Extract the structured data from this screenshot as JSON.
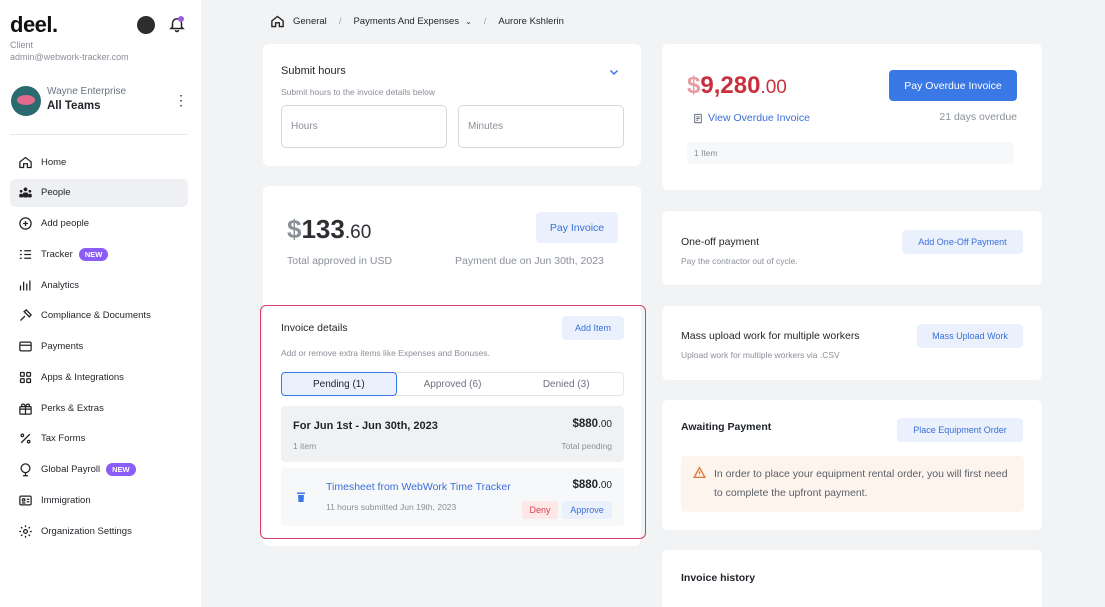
{
  "app": {
    "logo": "deel.",
    "role": "Client",
    "email": "admin@webwork-tracker.com"
  },
  "team": {
    "company": "Wayne Enterprise",
    "name": "All Teams"
  },
  "nav": [
    {
      "label": "Home",
      "icon": "home-icon",
      "badge": ""
    },
    {
      "label": "People",
      "icon": "people-icon",
      "badge": "",
      "active": true
    },
    {
      "label": "Add people",
      "icon": "add-circle-icon",
      "badge": ""
    },
    {
      "label": "Tracker",
      "icon": "tracker-list-icon",
      "badge": "NEW"
    },
    {
      "label": "Analytics",
      "icon": "bar-chart-icon",
      "badge": ""
    },
    {
      "label": "Compliance & Documents",
      "icon": "compliance-icon",
      "badge": ""
    },
    {
      "label": "Payments",
      "icon": "credit-card-icon",
      "badge": ""
    },
    {
      "label": "Apps & Integrations",
      "icon": "apps-grid-icon",
      "badge": ""
    },
    {
      "label": "Perks & Extras",
      "icon": "gift-icon",
      "badge": ""
    },
    {
      "label": "Tax Forms",
      "icon": "percent-icon",
      "badge": ""
    },
    {
      "label": "Global Payroll",
      "icon": "globe-pin-icon",
      "badge": "NEW"
    },
    {
      "label": "Immigration",
      "icon": "id-card-icon",
      "badge": ""
    },
    {
      "label": "Organization Settings",
      "icon": "gear-icon",
      "badge": ""
    }
  ],
  "breadcrumb": {
    "items": [
      "General",
      "Payments And Expenses",
      "Aurore Kshlerin"
    ]
  },
  "submit_hours": {
    "title": "Submit hours",
    "subtitle": "Submit hours to the invoice details below",
    "hours_placeholder": "Hours",
    "minutes_placeholder": "Minutes"
  },
  "invoice": {
    "currency_symbol": "$",
    "amount_whole": "133",
    "amount_cents": ".60",
    "total_label": "Total approved in USD",
    "due_label": "Payment due on Jun 30th, 2023",
    "pay_button": "Pay Invoice"
  },
  "invoice_details": {
    "title": "Invoice details",
    "subtitle": "Add or remove extra items like Expenses and Bonuses.",
    "add_item_button": "Add Item",
    "tabs": [
      {
        "label": "Pending (1)",
        "active": true
      },
      {
        "label": "Approved (6)",
        "active": false
      },
      {
        "label": "Denied (3)",
        "active": false
      }
    ],
    "period": {
      "label": "For Jun 1st - Jun 30th, 2023",
      "amount_whole": "$880",
      "amount_cents": ".00",
      "count": "1 item",
      "total_label": "Total pending"
    },
    "item": {
      "title": "Timesheet from WebWork Time Tracker",
      "subtitle": "11 hours submitted Jun 19th, 2023",
      "amount_whole": "$880",
      "amount_cents": ".00",
      "deny": "Deny",
      "approve": "Approve"
    }
  },
  "overdue": {
    "currency_symbol": "$",
    "amount_whole": "9,280",
    "amount_cents": ".00",
    "pay_button": "Pay Overdue Invoice",
    "view_link": "View Overdue Invoice",
    "days": "21 days overdue",
    "items": "1 Item"
  },
  "one_off": {
    "title": "One-off payment",
    "subtitle": "Pay the contractor out of cycle.",
    "button": "Add One-Off Payment"
  },
  "mass_upload": {
    "title": "Mass upload work for multiple workers",
    "subtitle": "Upload work for multiple workers via .CSV",
    "button": "Mass Upload Work"
  },
  "awaiting": {
    "title": "Awaiting Payment",
    "button": "Place Equipment Order",
    "warning": "In order to place your equipment rental order, you will first need to complete the upfront payment."
  },
  "history": {
    "title": "Invoice history"
  },
  "colors": {
    "accent": "#3a78e6",
    "overdue_red": "#c9303e",
    "badge_purple": "#8b5cf6",
    "highlight_border": "#d63d6b",
    "deny_red": "#d9434f"
  }
}
